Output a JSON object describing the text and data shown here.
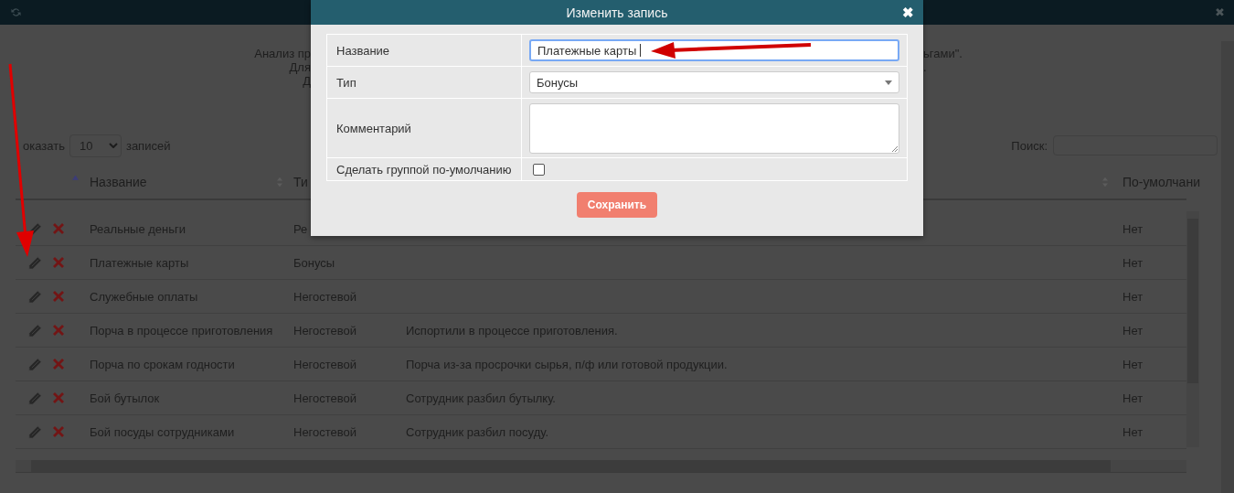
{
  "top_bar": {
    "refresh": true,
    "close": "✖"
  },
  "intro": {
    "left_lines": [
      "Анализ пр",
      "Для",
      "Д"
    ],
    "right_lines": [
      "ьгами\".",
      "."
    ]
  },
  "length_control": {
    "before": "оказать",
    "value": "10",
    "after": "записей"
  },
  "search": {
    "label": "Поиск:"
  },
  "table": {
    "columns": [
      {
        "sorted": true
      },
      {
        "label": "Название",
        "sorted": false
      },
      {
        "label": "Ти"
      },
      {},
      {
        "label": "По-умолчани",
        "sorted": false
      }
    ],
    "rows": [
      {
        "name": "Реальные деньги",
        "type": "Ре",
        "comment": "",
        "default": "Нет"
      },
      {
        "name": "Платежные карты",
        "type": "Бонусы",
        "comment": "",
        "default": "Нет"
      },
      {
        "name": "Служебные оплаты",
        "type": "Негостевой",
        "comment": "",
        "default": "Нет"
      },
      {
        "name": "Порча в процессе приготовления",
        "type": "Негостевой",
        "comment": "Испортили в процессе приготовления.",
        "default": "Нет"
      },
      {
        "name": "Порча по срокам годности",
        "type": "Негостевой",
        "comment": "Порча из-за просрочки сырья, п/ф или готовой продукции.",
        "default": "Нет"
      },
      {
        "name": "Бой бутылок",
        "type": "Негостевой",
        "comment": "Сотрудник разбил бутылку.",
        "default": "Нет"
      },
      {
        "name": "Бой посуды сотрудниками",
        "type": "Негостевой",
        "comment": "Сотрудник разбил посуду.",
        "default": "Нет"
      }
    ]
  },
  "modal": {
    "title": "Изменить запись",
    "close": "✖",
    "fields": [
      {
        "kind": "text",
        "label": "Название",
        "value": "Платежные карты",
        "focused": true
      },
      {
        "kind": "select",
        "label": "Тип",
        "value": "Бонусы"
      },
      {
        "kind": "textarea",
        "label": "Комментарий"
      },
      {
        "kind": "checkbox",
        "label": "Сделать группой по-умолчанию",
        "checked": false
      }
    ],
    "save_button": "Сохранить"
  }
}
